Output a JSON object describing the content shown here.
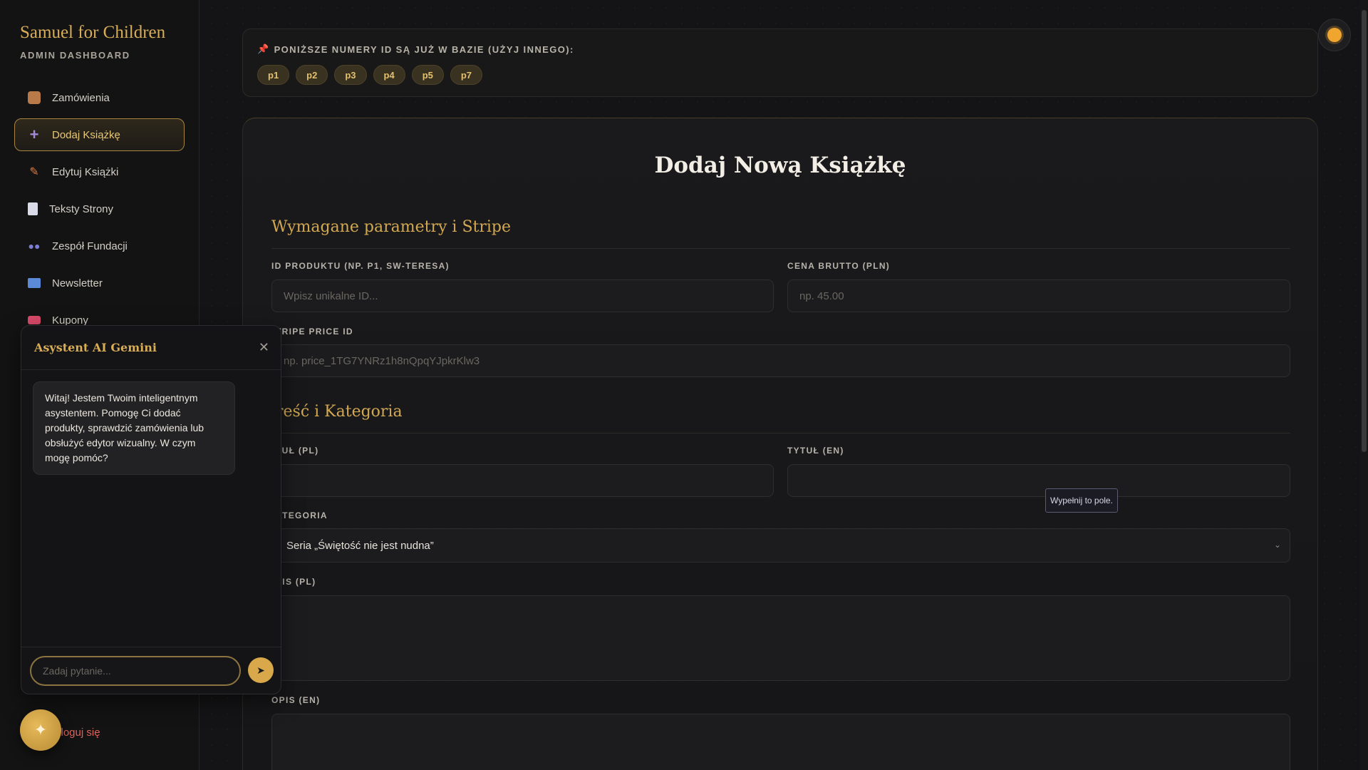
{
  "brand": {
    "title": "Samuel for Children",
    "subtitle": "ADMIN DASHBOARD"
  },
  "nav": {
    "items": [
      {
        "label": "Zamówienia",
        "icon": "package-icon",
        "color": "#c9895a"
      },
      {
        "label": "Dodaj Książkę",
        "icon": "plus-icon",
        "color": "#a48ad8",
        "active": true
      },
      {
        "label": "Edytuj Książki",
        "icon": "pencil-icon",
        "color": "#e07a40"
      },
      {
        "label": "Teksty Strony",
        "icon": "document-icon",
        "color": "#d9dbe8"
      },
      {
        "label": "Zespół Fundacji",
        "icon": "people-icon",
        "color": "#7b7ed8"
      },
      {
        "label": "Newsletter",
        "icon": "email-icon",
        "color": "#5b8ad8"
      },
      {
        "label": "Kupony",
        "icon": "ticket-icon",
        "color": "#d84a6a"
      }
    ],
    "logout": "yloguj się"
  },
  "ids_box": {
    "title": "PONIŻSZE NUMERY ID SĄ JUŻ W BAZIE (UŻYJ INNEGO):",
    "ids": [
      "p1",
      "p2",
      "p3",
      "p4",
      "p5",
      "p7"
    ]
  },
  "form": {
    "title": "Dodaj Nową Książkę",
    "section1": "Wymagane parametry i Stripe",
    "section2": "reść i Kategoria",
    "product_id": {
      "label": "ID PRODUKTU (NP. P1, SW-TERESA)",
      "placeholder": "Wpisz unikalne ID..."
    },
    "price": {
      "label": "CENA BRUTTO (PLN)",
      "placeholder": "np. 45.00"
    },
    "stripe": {
      "label": "TRIPE PRICE ID",
      "placeholder": "np. price_1TG7YNRz1h8nQpqYJpkrKlw3"
    },
    "title_pl": {
      "label": "TUŁ (PL)"
    },
    "title_en": {
      "label": "TYTUŁ (EN)"
    },
    "category": {
      "label": "ATEGORIA",
      "value": "Seria „Świętość nie jest nudna”"
    },
    "desc_pl": {
      "label": "PIS (PL)"
    },
    "desc_en": {
      "label": "OPIS (EN)"
    },
    "tooltip": "Wypełnij to pole."
  },
  "chat": {
    "title": "Asystent AI Gemini",
    "message": "Witaj! Jestem Twoim inteligentnym asystentem. Pomogę Ci dodać produkty, sprawdzić zamówienia lub obsłużyć edytor wizualny. W czym mogę pomóc?",
    "input_placeholder": "Zadaj pytanie..."
  }
}
